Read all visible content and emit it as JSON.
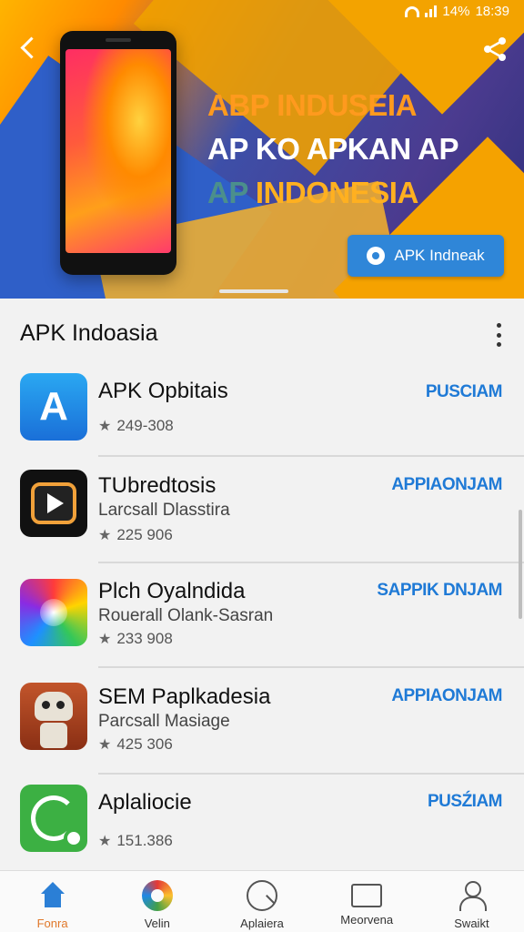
{
  "status_bar": {
    "battery": "14%",
    "time": "18:39"
  },
  "banner": {
    "headline_line1": "ABP INDUSEIA",
    "headline_line2": "AP KO APKAN AP",
    "headline_line3_prefix": "AP",
    "headline_line3_rest": " INDONESIA",
    "button_label": "APK Indneak",
    "colors": {
      "button": "#2f86d8",
      "orange": "#ff9a1e",
      "purple": "#4b3b8f"
    }
  },
  "section": {
    "title": "APK Indoasia"
  },
  "apps": [
    {
      "name": "APK Opbitais",
      "subtitle": "",
      "rating": "249-308",
      "action": "PUSCIAM",
      "icon": "apk-logo-icon"
    },
    {
      "name": "TUbredtosis",
      "subtitle": "Larcsall Dlasstira",
      "rating": "225 906",
      "action": "APPIAONJAM",
      "icon": "video-player-icon"
    },
    {
      "name": "Plch Oyalndida",
      "subtitle": "Rouerall Olank-Sasran",
      "rating": "233 908",
      "action": "SAPPIK DNJAM",
      "icon": "color-burst-icon"
    },
    {
      "name": "SEM Paplkadesia",
      "subtitle": "Parcsall Masiage",
      "rating": "425 306",
      "action": "APPIAONJAM",
      "icon": "robot-icon"
    },
    {
      "name": "Aplaliocie",
      "subtitle": "",
      "rating": "151.386",
      "action": "PUSŹIAM",
      "icon": "green-sync-icon"
    }
  ],
  "bottom_nav": [
    {
      "label": "Fonra",
      "icon": "home-icon",
      "active": true
    },
    {
      "label": "Velin",
      "icon": "color-wheel-icon",
      "active": false
    },
    {
      "label": "Aplaiera",
      "icon": "chat-icon",
      "active": false
    },
    {
      "label": "Meorvena",
      "icon": "tv-icon",
      "active": false
    },
    {
      "label": "Swaikt",
      "icon": "user-icon",
      "active": false
    }
  ]
}
